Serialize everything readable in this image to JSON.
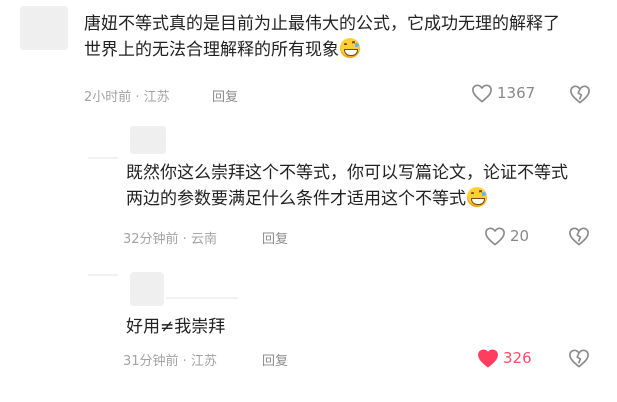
{
  "comments": [
    {
      "text_line1": "唐妞不等式真的是目前为止最伟大的公式，它成功无理的解释了",
      "text_line2": "世界上的无法合理解释的所有现象",
      "emoji": "grinning-sweat-emoji",
      "meta": "2小时前 · 江苏",
      "reply_label": "回复",
      "likes": "1367",
      "liked": false
    },
    {
      "text_line1": "既然你这么崇拜这个不等式，你可以写篇论文，论证不等式",
      "text_line2": "两边的参数要满足什么条件才适用这个不等式",
      "emoji": "grinning-sweat-emoji",
      "meta": "32分钟前 · 云南",
      "reply_label": "回复",
      "likes": "20",
      "liked": false
    },
    {
      "text_line1": "好用≠我崇拜",
      "meta": "31分钟前 · 江苏",
      "reply_label": "回复",
      "likes": "326",
      "liked": true
    }
  ],
  "colors": {
    "text": "#222222",
    "meta": "#a3a3a3",
    "liked": "#ff4d6a",
    "icon": "#8a8a8a"
  },
  "icons": [
    "heart-icon",
    "broken-heart-icon"
  ]
}
